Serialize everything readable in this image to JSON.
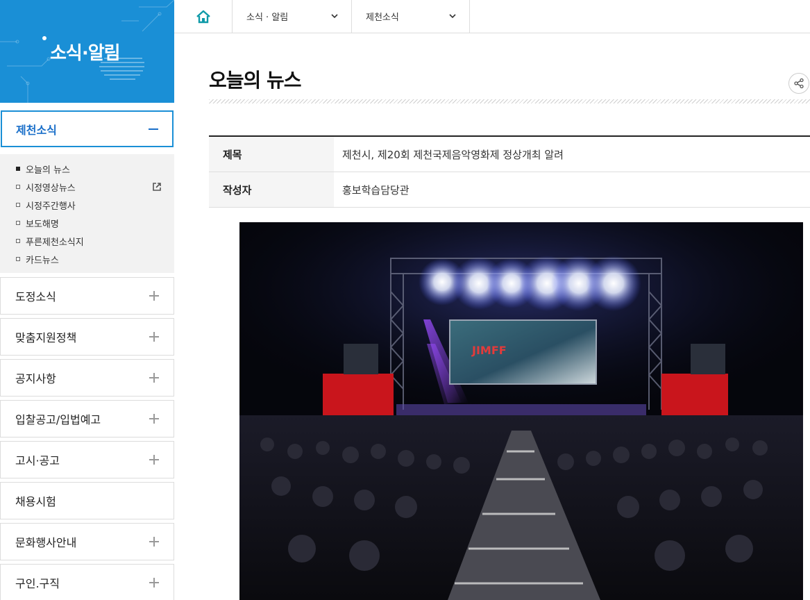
{
  "sidebar": {
    "banner_title": "소식·알림",
    "active_section": "제천소식",
    "sub_items": [
      {
        "label": "오늘의 뉴스",
        "current": true,
        "external": false
      },
      {
        "label": "시정영상뉴스",
        "current": false,
        "external": true
      },
      {
        "label": "시정주간행사",
        "current": false,
        "external": false
      },
      {
        "label": "보도해명",
        "current": false,
        "external": false
      },
      {
        "label": "푸른제천소식지",
        "current": false,
        "external": false
      },
      {
        "label": "카드뉴스",
        "current": false,
        "external": false
      }
    ],
    "menu": [
      {
        "label": "도정소식",
        "expandable": true
      },
      {
        "label": "맞춤지원정책",
        "expandable": true
      },
      {
        "label": "공지사항",
        "expandable": true
      },
      {
        "label": "입찰공고/입법예고",
        "expandable": true
      },
      {
        "label": "고시·공고",
        "expandable": true
      },
      {
        "label": "채용시험",
        "expandable": false
      },
      {
        "label": "문화행사안내",
        "expandable": true
      },
      {
        "label": "구인.구직",
        "expandable": true
      }
    ]
  },
  "breadcrumb": {
    "level1": "소식 · 알림",
    "level2": "제천소식"
  },
  "main": {
    "page_title": "오늘의 뉴스",
    "info": {
      "title_label": "제목",
      "title_value": "제천시, 제20회 제천국제음악영화제 정상개최 알려",
      "author_label": "작성자",
      "author_value": "홍보학습담당관"
    },
    "screen_text": "JIMFF"
  },
  "colors": {
    "accent": "#1a8fd6",
    "active_text": "#1a6fc9",
    "home_icon": "#0f9aa8",
    "stage_red": "#c9151c"
  }
}
